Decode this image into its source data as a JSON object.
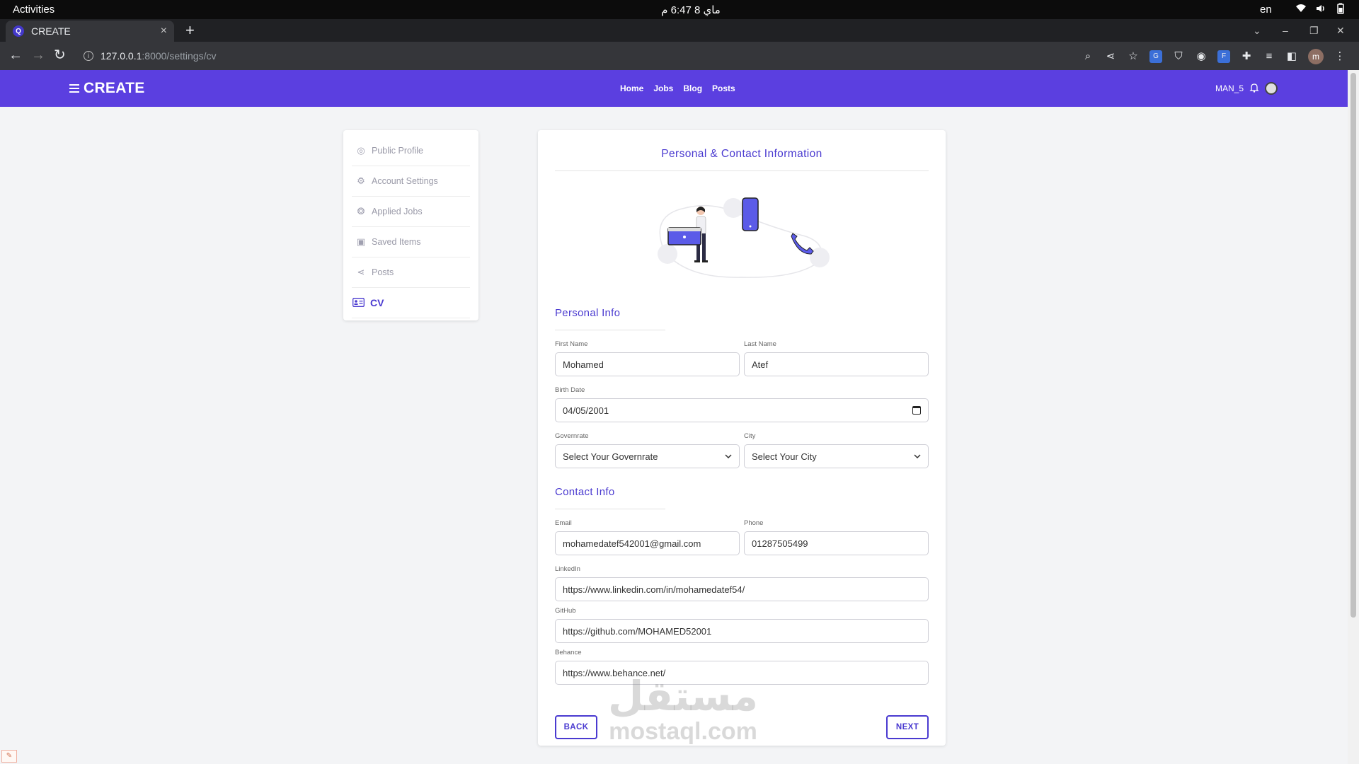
{
  "os": {
    "activities": "Activities",
    "clock": "ماي 8  6:47 م",
    "lang": "en"
  },
  "browser": {
    "tab_title": "CREATE",
    "url_host": "127.0.0.1",
    "url_path": ":8000/settings/cv",
    "avatar_letter": "m"
  },
  "site": {
    "brand": "CREATE",
    "nav": [
      "Home",
      "Jobs",
      "Blog",
      "Posts"
    ],
    "username": "MAN_5"
  },
  "sidebar": {
    "items": [
      {
        "label": "Public Profile",
        "icon": "user-circle-icon"
      },
      {
        "label": "Account Settings",
        "icon": "gear-icon"
      },
      {
        "label": "Applied Jobs",
        "icon": "fingerprint-icon"
      },
      {
        "label": "Saved Items",
        "icon": "save-icon"
      },
      {
        "label": "Posts",
        "icon": "share-icon"
      },
      {
        "label": "CV",
        "icon": "id-card-icon"
      }
    ],
    "active": "CV"
  },
  "form": {
    "title": "Personal & Contact Information",
    "personal_section": "Personal Info",
    "contact_section": "Contact Info",
    "first_name": {
      "label": "First Name",
      "value": "Mohamed"
    },
    "last_name": {
      "label": "Last Name",
      "value": "Atef"
    },
    "birth_date": {
      "label": "Birth Date",
      "value": "04/05/2001"
    },
    "governorate": {
      "label": "Governrate",
      "value": "Select Your Governrate"
    },
    "city": {
      "label": "City",
      "value": "Select Your City"
    },
    "email": {
      "label": "Email",
      "value": "mohamedatef542001@gmail.com"
    },
    "phone": {
      "label": "Phone",
      "value": "01287505499"
    },
    "linkedin": {
      "label": "LinkedIn",
      "value": "https://www.linkedin.com/in/mohamedatef54/"
    },
    "github": {
      "label": "GitHub",
      "value": "https://github.com/MOHAMED52001"
    },
    "behance": {
      "label": "Behance",
      "value": "https://www.behance.net/"
    },
    "back_label": "BACK",
    "next_label": "NEXT"
  },
  "watermark": {
    "arabic": "مستقل",
    "latin": "mostaql.com"
  },
  "colors": {
    "brand": "#5b3fe0",
    "accent": "#4a3ad0"
  }
}
